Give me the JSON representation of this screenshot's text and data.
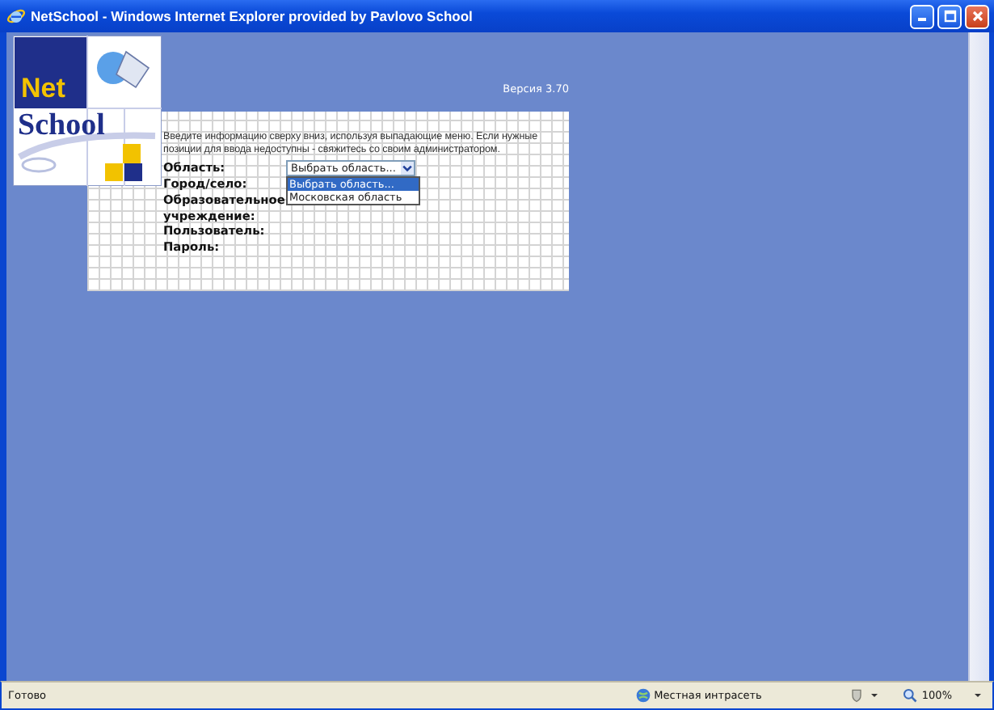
{
  "window": {
    "title": "NetSchool - Windows Internet Explorer provided by Pavlovo School"
  },
  "page": {
    "version": "Версия 3.70",
    "logo": {
      "line1": "Net",
      "line2": "School"
    },
    "instructions": "Введите информацию сверху вниз, используя выпадающие меню. Если нужные позиции для ввода недоступны - свяжитесь со своим администратором.",
    "fields": [
      {
        "label": "Область:",
        "kind": "select",
        "value": "Выбрать область..."
      },
      {
        "label": "Город/село:",
        "kind": "label"
      },
      {
        "label": "Образовательное учреждение:",
        "kind": "label"
      },
      {
        "label": "Пользователь:",
        "kind": "label"
      },
      {
        "label": "Пароль:",
        "kind": "label"
      }
    ],
    "dropdown": {
      "options": [
        {
          "label": "Выбрать область...",
          "selected": true
        },
        {
          "label": "Московская область",
          "selected": false
        }
      ]
    }
  },
  "status_bar": {
    "text": "Готово",
    "zone": "Местная интрасеть",
    "zoom": "100%"
  }
}
